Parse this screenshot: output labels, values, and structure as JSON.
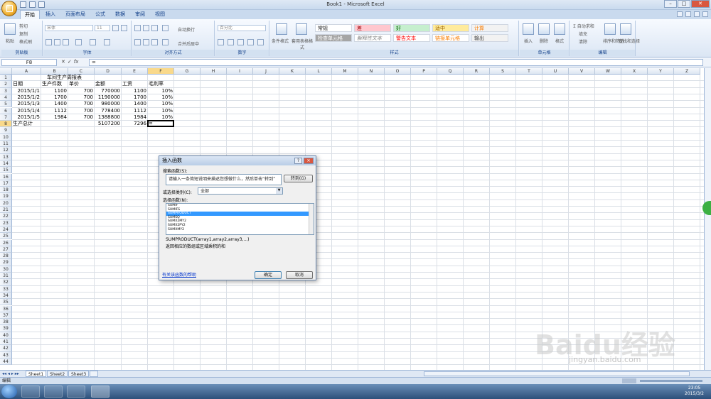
{
  "window": {
    "title": "Book1 - Microsoft Excel"
  },
  "ribbon_tabs": [
    "开始",
    "插入",
    "页面布局",
    "公式",
    "数据",
    "审阅",
    "视图"
  ],
  "ribbon": {
    "clipboard": {
      "paste": "粘贴",
      "cut": "剪切",
      "copy": "复制",
      "format_painter": "格式刷",
      "label": "剪贴板"
    },
    "font": {
      "name": "宋体",
      "size": "11",
      "label": "字体"
    },
    "alignment": {
      "wrap": "自动换行",
      "merge": "合并后居中",
      "label": "对齐方式"
    },
    "number": {
      "format": "百分比",
      "label": "数字"
    },
    "styles": {
      "conditional": "条件格式",
      "table": "套用表格格式",
      "normal": "常规",
      "bad": "差",
      "good": "好",
      "neutral": "适中",
      "calc": "计算",
      "check": "检查单元格",
      "explain": "解释性文本",
      "warn": "警告文本",
      "linked": "链接单元格",
      "output": "输出",
      "label": "样式"
    },
    "cells": {
      "insert": "插入",
      "delete": "删除",
      "format": "格式",
      "label": "单元格"
    },
    "editing": {
      "autosum": "自动求和",
      "fill": "填充",
      "clear": "清除",
      "sort": "排序和筛选",
      "find": "查找和选择",
      "label": "编辑"
    }
  },
  "formula_bar": {
    "name_box": "F8",
    "fx": "fx",
    "content": "="
  },
  "columns": [
    "A",
    "B",
    "C",
    "D",
    "E",
    "F",
    "G",
    "H",
    "I",
    "J",
    "K",
    "L",
    "M",
    "N",
    "O",
    "P",
    "Q",
    "R",
    "S",
    "T",
    "U",
    "V",
    "W",
    "X",
    "Y",
    "Z"
  ],
  "rows": [
    "1",
    "2",
    "3",
    "4",
    "5",
    "6",
    "7",
    "8",
    "9",
    "10",
    "11",
    "12",
    "13",
    "14",
    "15",
    "16",
    "17",
    "18",
    "19",
    "20",
    "21",
    "22",
    "23",
    "24",
    "25",
    "26",
    "27",
    "28",
    "29",
    "30",
    "31",
    "32",
    "33",
    "34",
    "35",
    "36",
    "37",
    "38",
    "39",
    "40",
    "41",
    "42",
    "43",
    "44"
  ],
  "sheet": {
    "title": "车间生产周报表",
    "headers": [
      "日期",
      "生产件数",
      "单价",
      "金额",
      "工资",
      "毛利率"
    ],
    "data": [
      [
        "2015/1/1",
        "1100",
        "700",
        "770000",
        "1100",
        "10%"
      ],
      [
        "2015/1/2",
        "1700",
        "700",
        "1190000",
        "1700",
        "10%"
      ],
      [
        "2015/1/3",
        "1400",
        "700",
        "980000",
        "1400",
        "10%"
      ],
      [
        "2015/1/4",
        "1112",
        "700",
        "778400",
        "1112",
        "10%"
      ],
      [
        "2015/1/5",
        "1984",
        "700",
        "1388800",
        "1984",
        "10%"
      ]
    ],
    "total": [
      "生产总计",
      "",
      "",
      "5107200",
      "7296",
      "="
    ]
  },
  "dialog": {
    "title": "插入函数",
    "search_label": "搜索函数(S):",
    "search_value": "请输入一条简短说明来描述您想做什么，然后单击“转到”",
    "go_button": "转到(G)",
    "category_label": "或选择类别(C):",
    "category_value": "全部",
    "select_label": "选择函数(N):",
    "functions": [
      "SUMIF",
      "SUMIFS",
      "SUMPRODUCT",
      "SUMSQ",
      "SUMX2MY2",
      "SUMX2PY2",
      "SUMXMY2"
    ],
    "selected_index": 2,
    "syntax": "SUMPRODUCT(array1,array2,array3,...)",
    "description": "返回相应的数组或区域乘积的和",
    "help_link": "有关该函数的帮助",
    "ok_button": "确定",
    "cancel_button": "取消"
  },
  "sheet_tabs": [
    "Sheet1",
    "Sheet2",
    "Sheet3"
  ],
  "status": "编辑",
  "clock": {
    "time": "23:05",
    "date": "2015/3/2"
  },
  "watermark": {
    "brand": "Baidu经验",
    "url": "jingyan.baidu.com"
  }
}
